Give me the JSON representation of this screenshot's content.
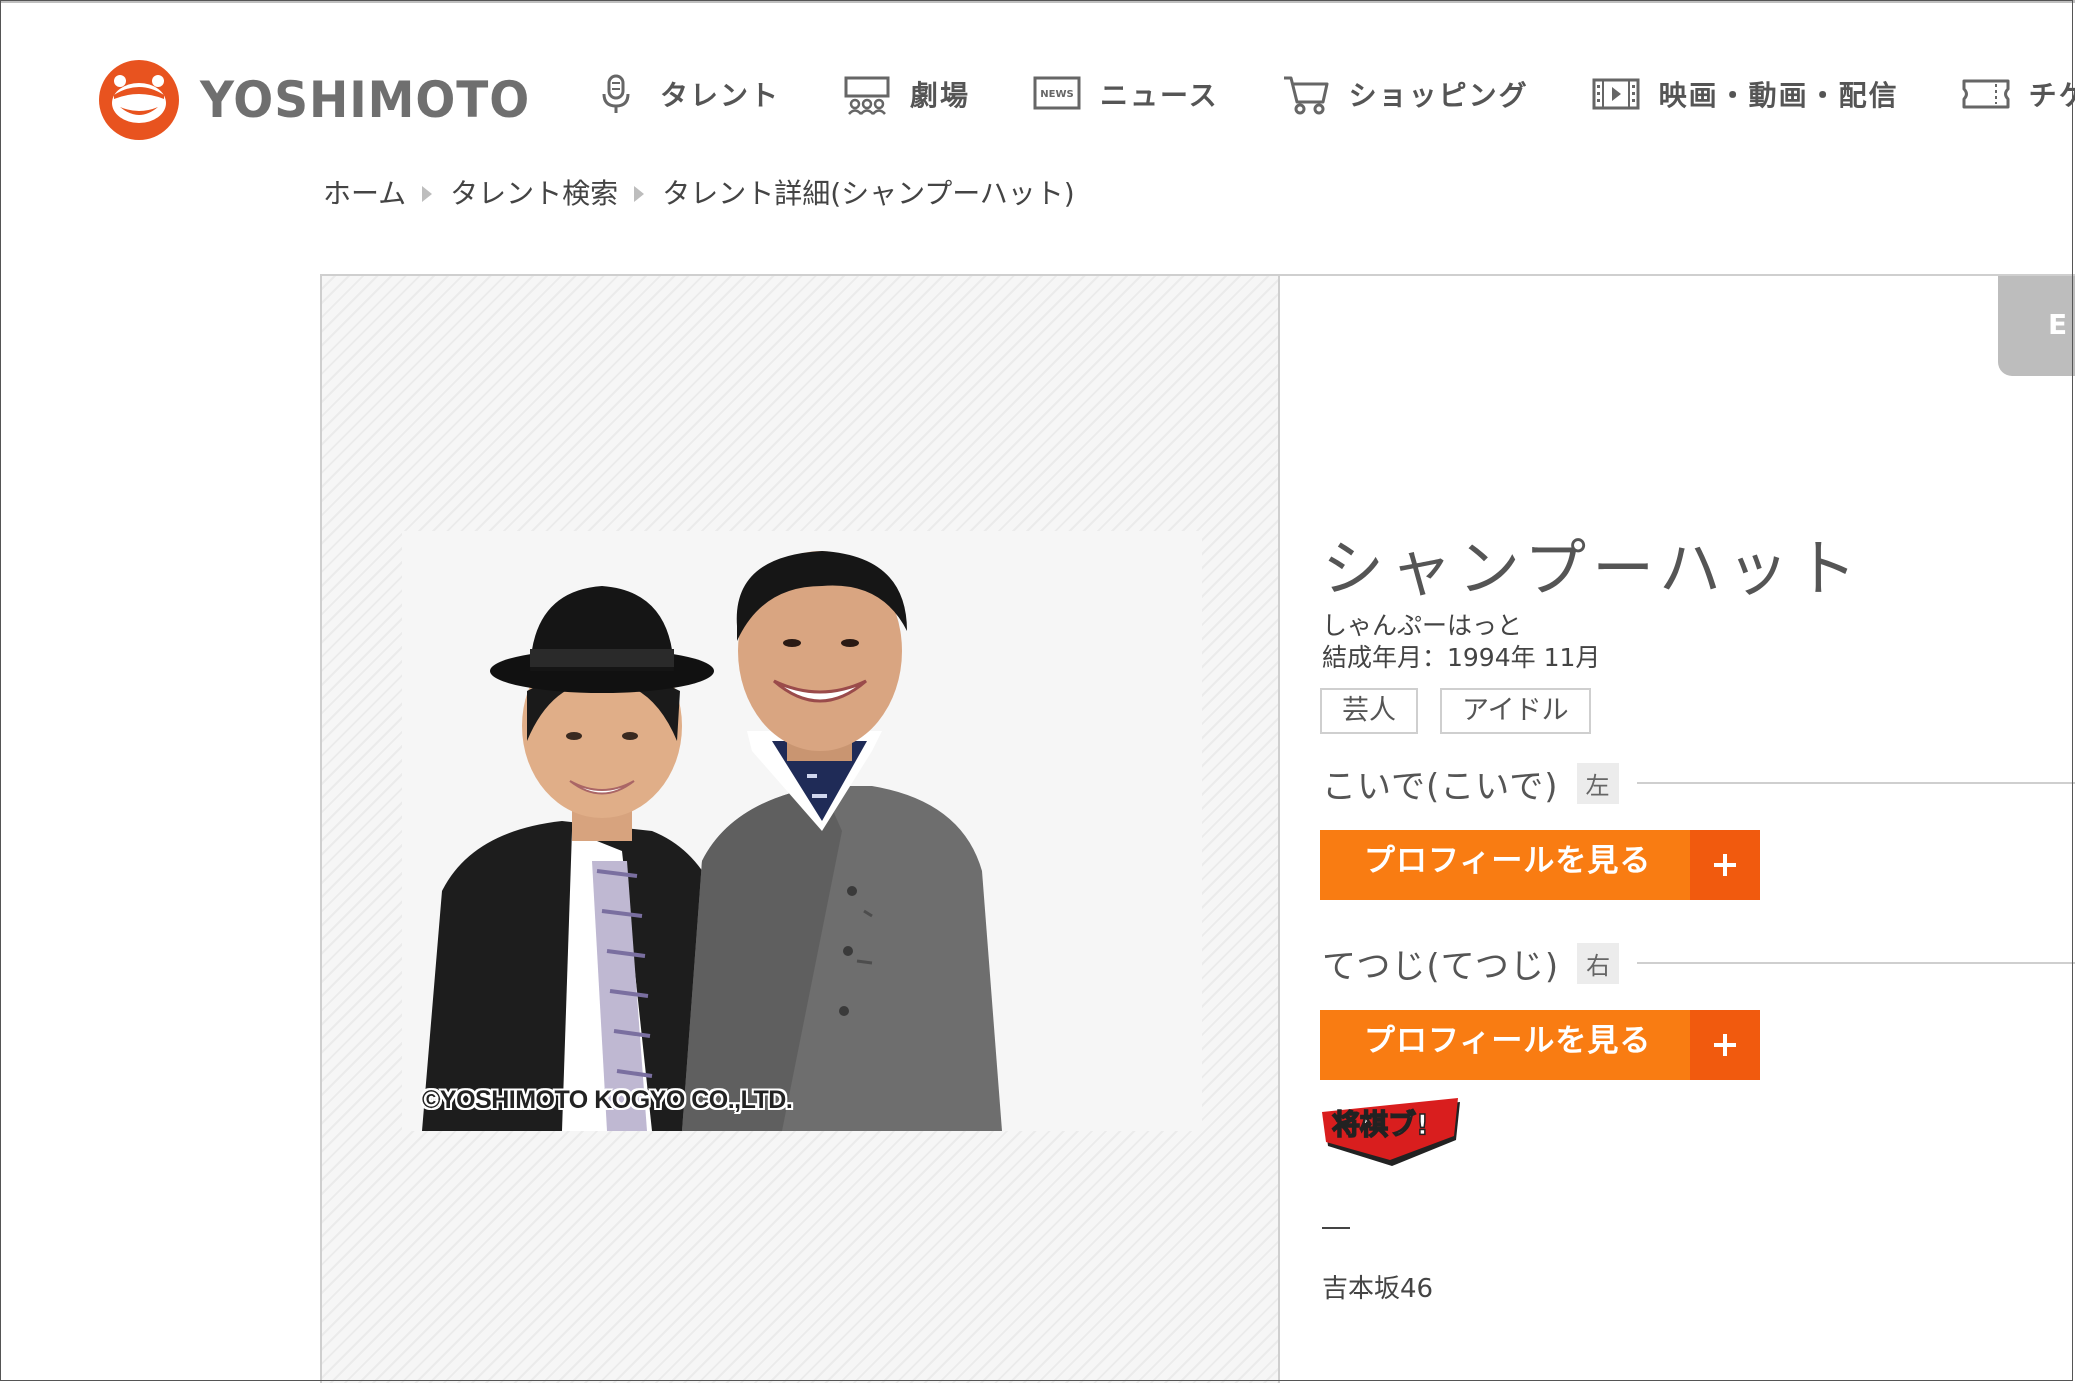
{
  "header": {
    "logo_text": "YOSHIMOTO",
    "brand_color": "#e8531f",
    "nav": [
      {
        "label": "タレント",
        "icon": "microphone-icon"
      },
      {
        "label": "劇場",
        "icon": "theater-icon"
      },
      {
        "label": "ニュース",
        "icon": "news-icon"
      },
      {
        "label": "ショッピング",
        "icon": "shopping-cart-icon"
      },
      {
        "label": "映画・動画・配信",
        "icon": "film-icon"
      },
      {
        "label": "チケット",
        "icon": "ticket-icon"
      }
    ]
  },
  "breadcrumb": {
    "home": "ホーム",
    "search": "タレント検索",
    "current": "タレント詳細(シャンプーハット)"
  },
  "photo": {
    "copyright": "©YOSHIMOTO KOGYO CO.,LTD."
  },
  "side_tab": {
    "label": "E"
  },
  "talent": {
    "name": "シャンプーハット",
    "reading": "しゃんぷーはっと",
    "formed": "結成年月：1994年 11月",
    "tags": [
      "芸人",
      "アイドル"
    ],
    "members": [
      {
        "name": "こいで(こいで)",
        "position": "左",
        "button": "プロフィールを見る"
      },
      {
        "name": "てつじ(てつじ)",
        "position": "右",
        "button": "プロフィールを見る"
      }
    ],
    "badge_text": "将棋ブ!",
    "dash": "—",
    "group": "吉本坂46"
  },
  "colors": {
    "button": "#f97c12",
    "button_plus": "#f15a0e",
    "badge_red": "#d91e1e"
  }
}
